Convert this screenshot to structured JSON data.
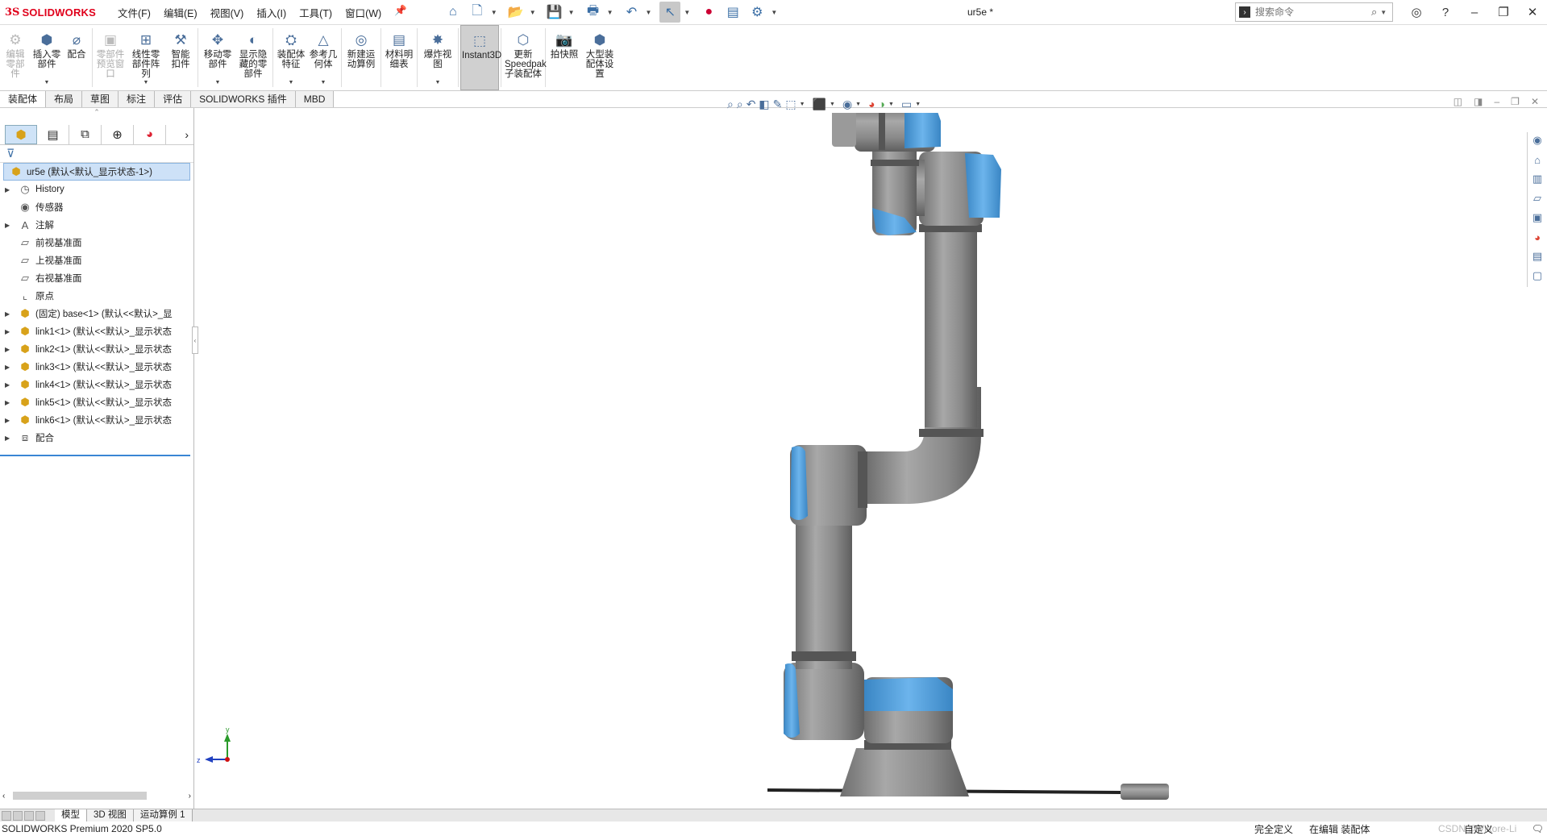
{
  "app": {
    "logo_ds": "3S",
    "logo_name": "SOLIDWORKS",
    "doc_title": "ur5e *"
  },
  "menus": [
    "文件(F)",
    "编辑(E)",
    "视图(V)",
    "插入(I)",
    "工具(T)",
    "窗口(W)"
  ],
  "search": {
    "placeholder": "搜索命令"
  },
  "ribbon": [
    {
      "label": "编辑零部件",
      "icon": "edit-component-icon",
      "disabled": true,
      "dropdown": false
    },
    {
      "label": "插入零部件",
      "icon": "insert-component-icon",
      "disabled": false,
      "dropdown": true
    },
    {
      "label": "配合",
      "icon": "mate-icon",
      "disabled": false,
      "dropdown": false
    },
    {
      "label": "零部件预览窗口",
      "icon": "component-preview-icon",
      "disabled": true,
      "dropdown": false
    },
    {
      "label": "线性零部件阵列",
      "icon": "linear-pattern-icon",
      "disabled": false,
      "dropdown": true
    },
    {
      "label": "智能扣件",
      "icon": "smart-fastener-icon",
      "disabled": false,
      "dropdown": false
    },
    {
      "label": "移动零部件",
      "icon": "move-component-icon",
      "disabled": false,
      "dropdown": true
    },
    {
      "label": "显示隐藏的零部件",
      "icon": "show-hidden-icon",
      "disabled": false,
      "dropdown": false
    },
    {
      "label": "装配体特征",
      "icon": "assembly-feature-icon",
      "disabled": false,
      "dropdown": true
    },
    {
      "label": "参考几何体",
      "icon": "reference-geometry-icon",
      "disabled": false,
      "dropdown": true
    },
    {
      "label": "新建运动算例",
      "icon": "motion-study-icon",
      "disabled": false,
      "dropdown": false
    },
    {
      "label": "材料明细表",
      "icon": "bom-icon",
      "disabled": false,
      "dropdown": false
    },
    {
      "label": "爆炸视图",
      "icon": "exploded-view-icon",
      "disabled": false,
      "dropdown": true
    },
    {
      "label": "Instant3D",
      "icon": "instant3d-icon",
      "disabled": false,
      "dropdown": false,
      "active": true
    },
    {
      "label": "更新Speedpak子装配体",
      "icon": "speedpak-icon",
      "disabled": false,
      "dropdown": false
    },
    {
      "label": "拍快照",
      "icon": "snapshot-icon",
      "disabled": false,
      "dropdown": false
    },
    {
      "label": "大型装配体设置",
      "icon": "large-assembly-icon",
      "disabled": false,
      "dropdown": false
    }
  ],
  "command_tabs": [
    "装配体",
    "布局",
    "草图",
    "标注",
    "评估",
    "SOLIDWORKS 插件",
    "MBD"
  ],
  "tree": [
    {
      "label": "ur5e  (默认<默认_显示状态-1>)",
      "icon": "assembly-icon",
      "expand": false,
      "root": true
    },
    {
      "label": "History",
      "icon": "history-icon",
      "expand": true
    },
    {
      "label": "传感器",
      "icon": "sensor-icon",
      "expand": false
    },
    {
      "label": "注解",
      "icon": "annotation-icon",
      "expand": true
    },
    {
      "label": "前视基准面",
      "icon": "plane-icon",
      "expand": false
    },
    {
      "label": "上视基准面",
      "icon": "plane-icon",
      "expand": false
    },
    {
      "label": "右视基准面",
      "icon": "plane-icon",
      "expand": false
    },
    {
      "label": "原点",
      "icon": "origin-icon",
      "expand": false
    },
    {
      "label": "(固定) base<1> (默认<<默认>_显",
      "icon": "part-icon",
      "expand": true
    },
    {
      "label": "link1<1> (默认<<默认>_显示状态",
      "icon": "part-icon",
      "expand": true
    },
    {
      "label": "link2<1> (默认<<默认>_显示状态",
      "icon": "part-icon",
      "expand": true
    },
    {
      "label": "link3<1> (默认<<默认>_显示状态",
      "icon": "part-icon",
      "expand": true
    },
    {
      "label": "link4<1> (默认<<默认>_显示状态",
      "icon": "part-icon",
      "expand": true
    },
    {
      "label": "link5<1> (默认<<默认>_显示状态",
      "icon": "part-icon",
      "expand": true
    },
    {
      "label": "link6<1> (默认<<默认>_显示状态",
      "icon": "part-icon",
      "expand": true
    },
    {
      "label": "配合",
      "icon": "mates-folder-icon",
      "expand": true
    }
  ],
  "triad": {
    "x": "",
    "y": "y",
    "z": "z"
  },
  "bottom_tabs": [
    "模型",
    "3D 视图",
    "运动算例 1"
  ],
  "status": {
    "product": "SOLIDWORKS Premium 2020 SP5.0",
    "state": "完全定义",
    "mode": "在编辑 装配体",
    "units": "自定义",
    "watermark": "CSDN @Vittore-Li"
  },
  "colors": {
    "robot_gray": "#8e8e8e",
    "robot_blue": "#4c9fd8",
    "accent": "#3a86d4",
    "brand": "#e0001b"
  }
}
